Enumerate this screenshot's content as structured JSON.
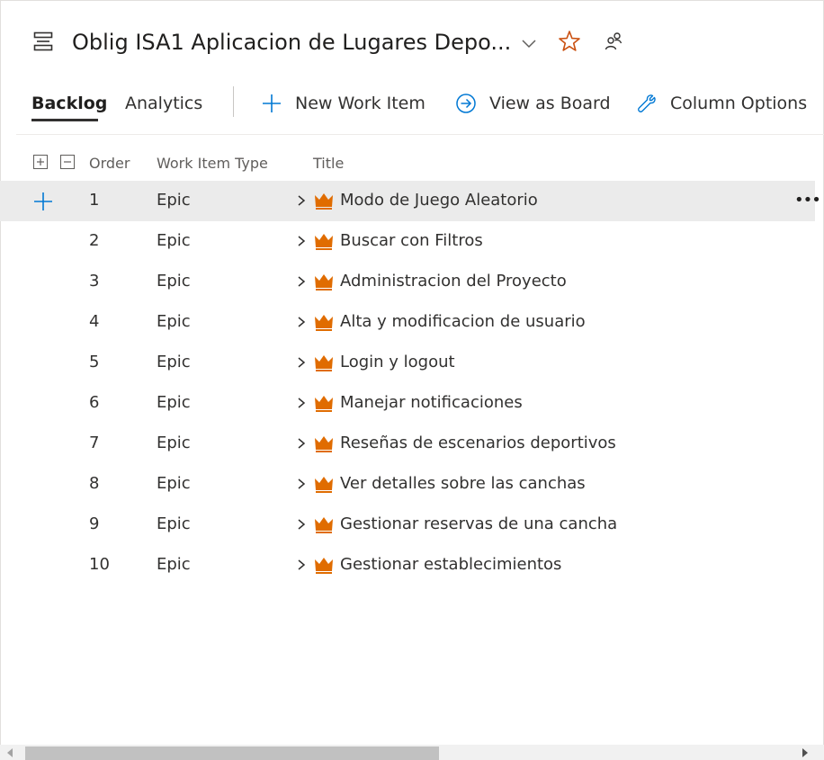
{
  "header": {
    "title": "Oblig ISA1 Aplicacion de Lugares Depo...",
    "backlog_icon": "backlog-icon",
    "dropdown_icon": "chevron-down-icon",
    "favorite_icon": "star-icon",
    "team_icon": "people-icon",
    "accent_color": "#ca5010"
  },
  "toolbar": {
    "tabs": [
      {
        "label": "Backlog",
        "selected": true
      },
      {
        "label": "Analytics",
        "selected": false
      }
    ],
    "new_work_item": "New Work Item",
    "view_as_board": "View as Board",
    "column_options": "Column Options"
  },
  "grid": {
    "columns": [
      "Order",
      "Work Item Type",
      "Title"
    ],
    "rows": [
      {
        "order": "1",
        "type": "Epic",
        "title": "Modo de Juego Aleatorio",
        "selected": true
      },
      {
        "order": "2",
        "type": "Epic",
        "title": "Buscar con Filtros"
      },
      {
        "order": "3",
        "type": "Epic",
        "title": "Administracion del Proyecto"
      },
      {
        "order": "4",
        "type": "Epic",
        "title": "Alta y modificacion de usuario"
      },
      {
        "order": "5",
        "type": "Epic",
        "title": "Login y logout"
      },
      {
        "order": "6",
        "type": "Epic",
        "title": "Manejar notificaciones"
      },
      {
        "order": "7",
        "type": "Epic",
        "title": "Reseñas de escenarios deportivos"
      },
      {
        "order": "8",
        "type": "Epic",
        "title": "Ver detalles sobre las canchas"
      },
      {
        "order": "9",
        "type": "Epic",
        "title": "Gestionar reservas de una cancha"
      },
      {
        "order": "10",
        "type": "Epic",
        "title": "Gestionar establecimientos"
      }
    ],
    "epic_icon": "crown-icon",
    "epic_color": "#e06c00",
    "more_label": "•••"
  }
}
